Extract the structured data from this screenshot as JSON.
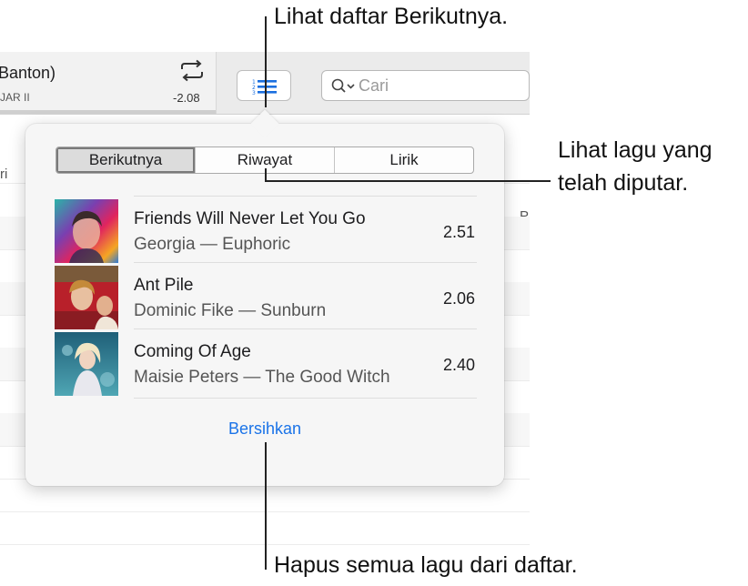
{
  "toolbar": {
    "now_playing_title": "Banton)",
    "now_playing_subtitle": "JAR II",
    "time_remaining": "-2.08",
    "search_placeholder": "Cari"
  },
  "background_fragments": {
    "col_left": "ri",
    "col_right": "P"
  },
  "popover": {
    "tabs": [
      {
        "label": "Berikutnya",
        "active": true
      },
      {
        "label": "Riwayat",
        "active": false
      },
      {
        "label": "Lirik",
        "active": false
      }
    ],
    "tracks": [
      {
        "title": "Friends Will Never Let You Go",
        "subtitle": "Georgia — Euphoric",
        "duration": "2.51"
      },
      {
        "title": "Ant Pile",
        "subtitle": "Dominic Fike — Sunburn",
        "duration": "2.06"
      },
      {
        "title": "Coming Of Age",
        "subtitle": "Maisie Peters — The Good Witch",
        "duration": "2.40"
      }
    ],
    "clear_label": "Bersihkan"
  },
  "callouts": {
    "up_next": "Lihat daftar Berikutnya.",
    "history_line1": "Lihat lagu yang",
    "history_line2": "telah diputar.",
    "clear": "Hapus semua lagu dari daftar."
  },
  "colors": {
    "accent": "#1a73e8",
    "upnext_icon": "#1a6fe0"
  }
}
